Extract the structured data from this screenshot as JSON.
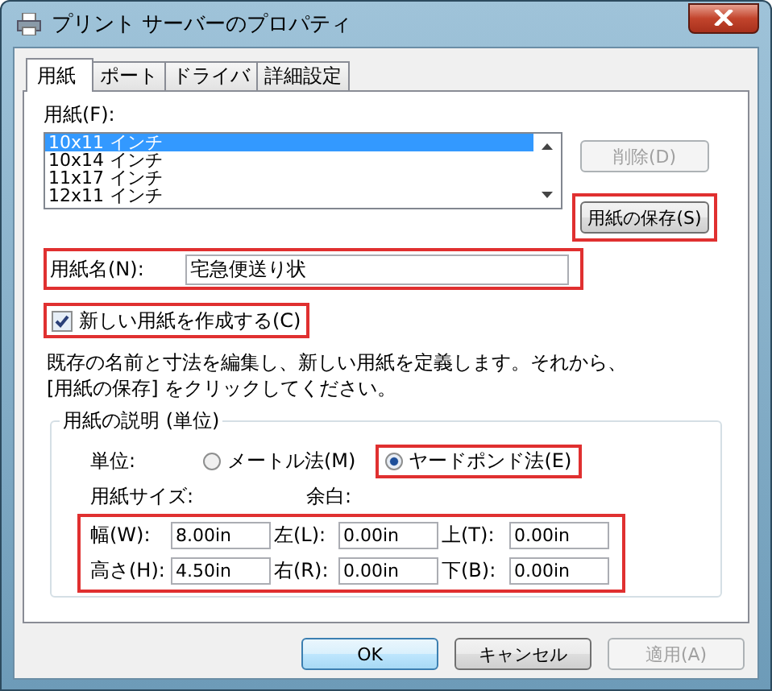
{
  "window": {
    "title": "プリント サーバーのプロパティ"
  },
  "tabs": [
    {
      "label": "用紙",
      "selected": true
    },
    {
      "label": "ポート",
      "selected": false
    },
    {
      "label": "ドライバ",
      "selected": false
    },
    {
      "label": "詳細設定",
      "selected": false
    }
  ],
  "paper_list": {
    "label": "用紙(F):",
    "items": [
      {
        "text": "10x11 インチ",
        "selected": true
      },
      {
        "text": "10x14 インチ",
        "selected": false
      },
      {
        "text": "11x17 インチ",
        "selected": false
      },
      {
        "text": "12x11 インチ",
        "selected": false
      }
    ]
  },
  "delete_button": {
    "label": "削除(D)",
    "disabled": true,
    "highlighted": false
  },
  "save_button": {
    "label": "用紙の保存(S)",
    "disabled": false,
    "highlighted": true
  },
  "paper_name": {
    "label": "用紙名(N):",
    "value": "宅急便送り状",
    "highlighted": true
  },
  "new_paper": {
    "label": "新しい用紙を作成する(C)",
    "checked": true,
    "highlighted": true
  },
  "description": [
    "既存の名前と寸法を編集し、新しい用紙を定義します。それから、",
    "[用紙の保存] をクリックしてください。"
  ],
  "group": {
    "title": "用紙の説明 (単位)",
    "unit_label": "単位:",
    "units": [
      {
        "label": "メートル法(M)",
        "selected": false,
        "highlighted": false
      },
      {
        "label": "ヤードポンド法(E)",
        "selected": true,
        "highlighted": true
      }
    ],
    "size_label": "用紙サイズ:",
    "margin_label": "余白:",
    "fields_highlighted": true,
    "fields": [
      {
        "label": "幅(W):",
        "value": "8.00in"
      },
      {
        "label": "左(L):",
        "value": "0.00in"
      },
      {
        "label": "上(T):",
        "value": "0.00in"
      },
      {
        "label": "高さ(H):",
        "value": "4.50in"
      },
      {
        "label": "右(R):",
        "value": "0.00in"
      },
      {
        "label": "下(B):",
        "value": "0.00in"
      }
    ]
  },
  "buttons": [
    {
      "label": "OK",
      "default": true,
      "disabled": false
    },
    {
      "label": "キャンセル",
      "default": false,
      "disabled": false
    },
    {
      "label": "適用(A)",
      "default": false,
      "disabled": true
    }
  ]
}
